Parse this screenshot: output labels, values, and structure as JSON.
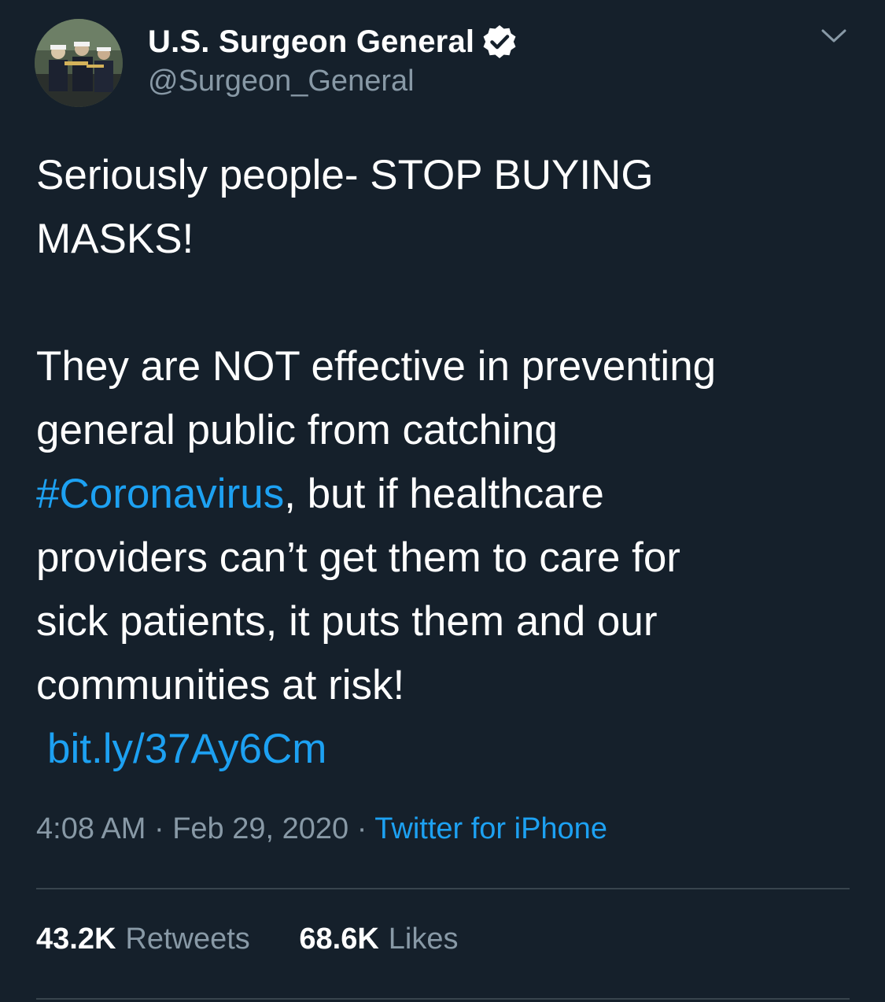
{
  "theme": {
    "background": "#15202b",
    "text_primary": "#ffffff",
    "text_secondary": "#8899a6",
    "link": "#1da1f2",
    "divider": "#38444d"
  },
  "author": {
    "display_name": "U.S. Surgeon General",
    "handle": "@Surgeon_General",
    "verified": true,
    "verified_icon": "verified-badge-icon",
    "avatar": "profile-photo-officers"
  },
  "menu": {
    "icon": "chevron-down-icon"
  },
  "tweet": {
    "lines": [
      "Seriously people- STOP BUYING",
      "MASKS!",
      "They are NOT effective in preventing",
      "general public from catching"
    ],
    "hashtag": "#Coronavirus",
    "after_hashtag": ", but if healthcare",
    "lines_after": [
      "providers can’t get them to care for",
      "sick patients, it puts them and our",
      "communities at risk!"
    ],
    "link": "bit.ly/37Ay6Cm"
  },
  "meta": {
    "time": "4:08 AM",
    "separator": "·",
    "date": "Feb 29, 2020",
    "source": "Twitter for iPhone"
  },
  "stats": {
    "retweets_count": "43.2K",
    "retweets_label": "Retweets",
    "likes_count": "68.6K",
    "likes_label": "Likes"
  }
}
